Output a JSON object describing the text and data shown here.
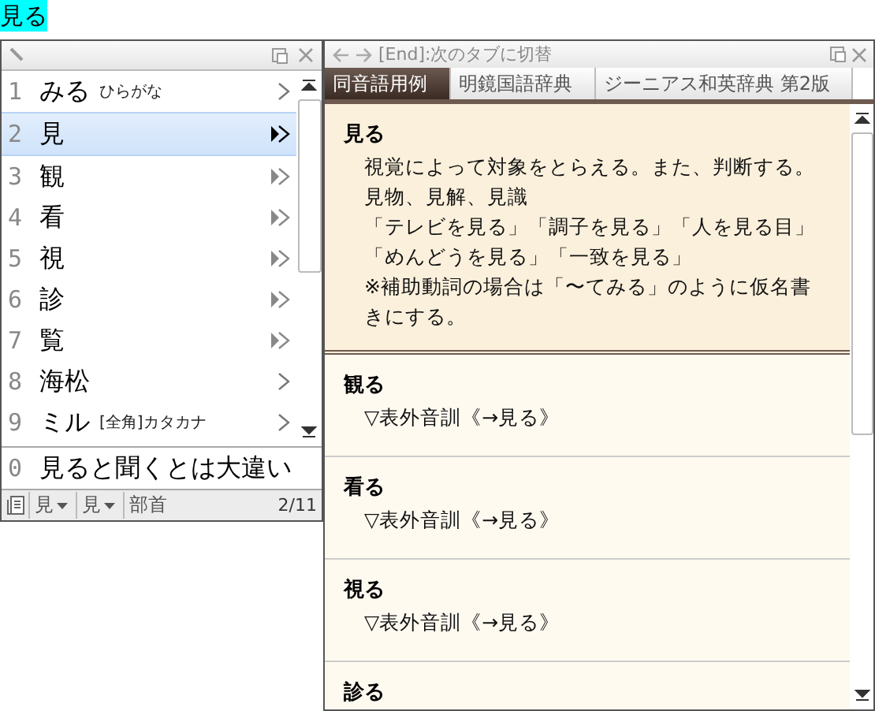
{
  "composition": {
    "text": "見る"
  },
  "candidates": {
    "items": [
      {
        "number": "1",
        "text": "みる",
        "note": "ひらがな",
        "kind": "single",
        "selected": false
      },
      {
        "number": "2",
        "text": "見",
        "kind": "double",
        "selected": true
      },
      {
        "number": "3",
        "text": "観",
        "kind": "double",
        "selected": false
      },
      {
        "number": "4",
        "text": "看",
        "kind": "double",
        "selected": false
      },
      {
        "number": "5",
        "text": "視",
        "kind": "double",
        "selected": false
      },
      {
        "number": "6",
        "text": "診",
        "kind": "double",
        "selected": false
      },
      {
        "number": "7",
        "text": "覧",
        "kind": "double",
        "selected": false
      },
      {
        "number": "8",
        "text": "海松",
        "kind": "single",
        "selected": false
      },
      {
        "number": "9",
        "text": "ミル",
        "note": "[全角]カタカナ",
        "kind": "single",
        "selected": false
      }
    ],
    "prediction": {
      "number": "0",
      "text": "見ると聞くとは大違い"
    },
    "toolbar": {
      "first": "見",
      "second": "見",
      "radical": "部首",
      "page": "2/11"
    }
  },
  "dictionary": {
    "title": "[End]:次のタブに切替",
    "tabs": [
      {
        "label": "同音語用例",
        "selected": true
      },
      {
        "label": "明鏡国語辞典",
        "selected": false
      },
      {
        "label": "ジーニアス和英辞典 第2版",
        "selected": false
      }
    ],
    "entries": [
      {
        "heading": "見る",
        "highlighted": true,
        "lines": [
          "視覚によって対象をとらえる。また、判断する。",
          "見物、見解、見識",
          "「テレビを見る」「調子を見る」「人を見る目」",
          "「めんどうを見る」「一致を見る」",
          "※補助動詞の場合は「〜てみる」のように仮名書きにする。"
        ]
      },
      {
        "heading": "観る",
        "highlighted": false,
        "lines": [
          "▽表外音訓《→見る》"
        ]
      },
      {
        "heading": "看る",
        "highlighted": false,
        "lines": [
          "▽表外音訓《→見る》"
        ]
      },
      {
        "heading": "視る",
        "highlighted": false,
        "lines": [
          "▽表外音訓《→見る》"
        ]
      },
      {
        "heading": "診る",
        "highlighted": false
      }
    ]
  }
}
